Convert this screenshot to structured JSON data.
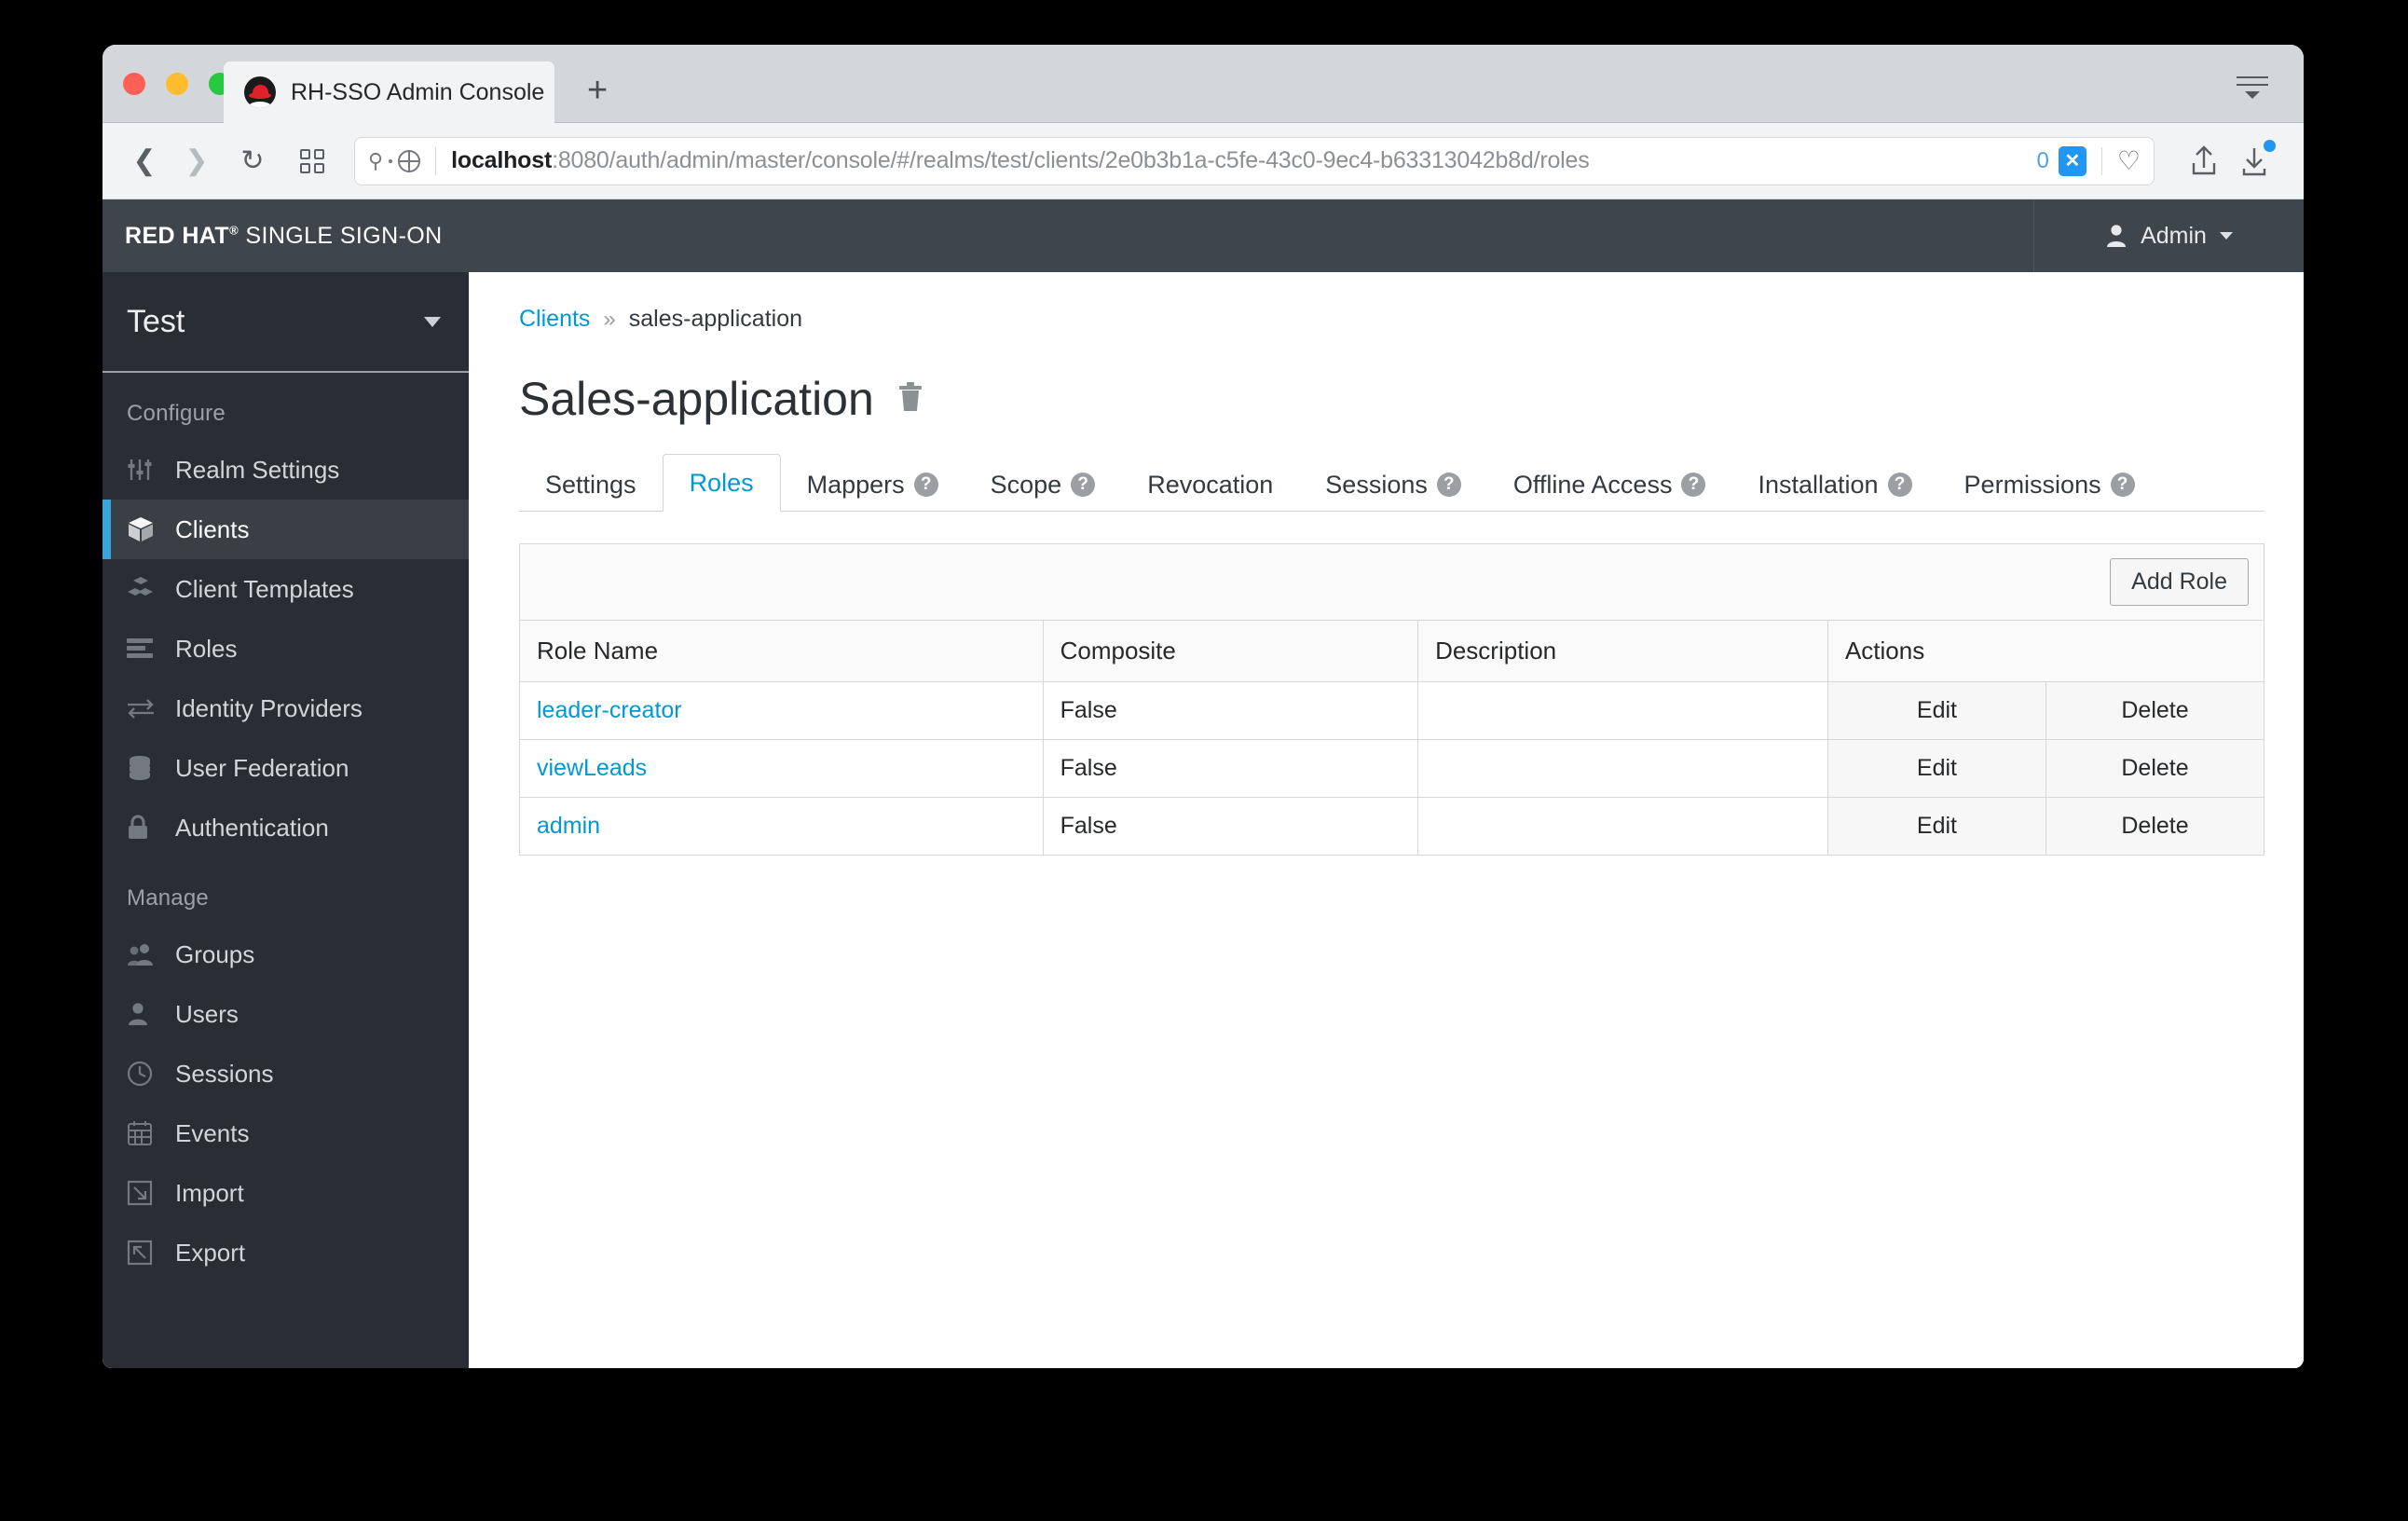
{
  "browser": {
    "tab": {
      "title": "RH-SSO Admin Console",
      "favicon": "redhat-fedora-icon"
    },
    "new_tab_label": "+",
    "url": {
      "host": "localhost",
      "path": ":8080/auth/admin/master/console/#/realms/test/clients/2e0b3b1a-c5fe-43c0-9ec4-b63313042b8d/roles",
      "blocked_count": "0",
      "blocked_badge": "✕"
    }
  },
  "header": {
    "brand_bold": "RED HAT",
    "brand_registered": "®",
    "brand_light": "SINGLE SIGN-ON",
    "user": "Admin"
  },
  "sidebar": {
    "realm": "Test",
    "groups": [
      {
        "title": "Configure",
        "items": [
          {
            "label": "Realm Settings",
            "icon": "sliders-icon",
            "active": false
          },
          {
            "label": "Clients",
            "icon": "cube-icon",
            "active": true
          },
          {
            "label": "Client Templates",
            "icon": "cubes-icon",
            "active": false
          },
          {
            "label": "Roles",
            "icon": "list-icon",
            "active": false
          },
          {
            "label": "Identity Providers",
            "icon": "exchange-icon",
            "active": false
          },
          {
            "label": "User Federation",
            "icon": "database-icon",
            "active": false
          },
          {
            "label": "Authentication",
            "icon": "lock-icon",
            "active": false
          }
        ]
      },
      {
        "title": "Manage",
        "items": [
          {
            "label": "Groups",
            "icon": "users-icon",
            "active": false
          },
          {
            "label": "Users",
            "icon": "user-icon",
            "active": false
          },
          {
            "label": "Sessions",
            "icon": "clock-icon",
            "active": false
          },
          {
            "label": "Events",
            "icon": "calendar-icon",
            "active": false
          },
          {
            "label": "Import",
            "icon": "import-icon",
            "active": false
          },
          {
            "label": "Export",
            "icon": "export-icon",
            "active": false
          }
        ]
      }
    ]
  },
  "main": {
    "breadcrumb": {
      "root": "Clients",
      "separator": "»",
      "current": "sales-application"
    },
    "page_title": "Sales-application",
    "delete_icon": "trash-icon",
    "tabs": [
      {
        "label": "Settings",
        "help": false,
        "active": false
      },
      {
        "label": "Roles",
        "help": false,
        "active": true
      },
      {
        "label": "Mappers",
        "help": true,
        "active": false
      },
      {
        "label": "Scope",
        "help": true,
        "active": false
      },
      {
        "label": "Revocation",
        "help": false,
        "active": false
      },
      {
        "label": "Sessions",
        "help": true,
        "active": false
      },
      {
        "label": "Offline Access",
        "help": true,
        "active": false
      },
      {
        "label": "Installation",
        "help": true,
        "active": false
      },
      {
        "label": "Permissions",
        "help": true,
        "active": false
      }
    ],
    "add_role_label": "Add Role",
    "table": {
      "columns": [
        "Role Name",
        "Composite",
        "Description",
        "Actions"
      ],
      "rows": [
        {
          "role_name": "leader-creator",
          "composite": "False",
          "description": "",
          "edit": "Edit",
          "delete": "Delete"
        },
        {
          "role_name": "viewLeads",
          "composite": "False",
          "description": "",
          "edit": "Edit",
          "delete": "Delete"
        },
        {
          "role_name": "admin",
          "composite": "False",
          "description": "",
          "edit": "Edit",
          "delete": "Delete"
        }
      ]
    }
  },
  "colors": {
    "brand_dark": "#3f454c",
    "sidebar": "#292e34",
    "accent_blue": "#0099d3",
    "active_bar": "#39a5dc"
  }
}
